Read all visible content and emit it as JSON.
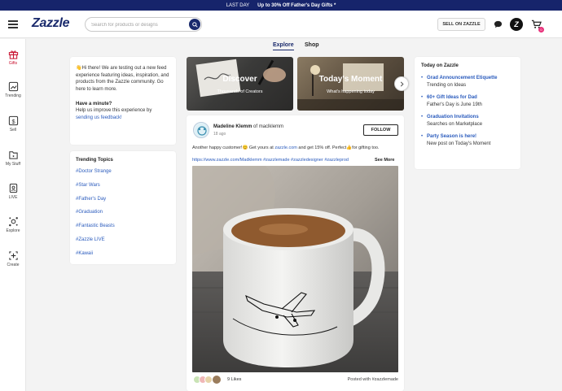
{
  "promo": {
    "label": "LAST DAY",
    "text": "Up to 30% Off Father's Day Gifts *"
  },
  "header": {
    "logo": "Zazzle",
    "search_placeholder": "Search for products or designs",
    "sell_label": "SELL ON ZAZZLE",
    "cart_count": "0"
  },
  "leftnav": [
    {
      "label": "Gifts",
      "icon": "gift-icon"
    },
    {
      "label": "Trending",
      "icon": "trending-icon"
    },
    {
      "label": "Sell",
      "icon": "dollar-icon"
    },
    {
      "label": "My Stuff",
      "icon": "my-stuff-icon"
    },
    {
      "label": "LIVE",
      "icon": "live-icon"
    },
    {
      "label": "Explore",
      "icon": "explore-icon"
    },
    {
      "label": "Create",
      "icon": "create-icon"
    }
  ],
  "tabs": [
    {
      "label": "Explore"
    },
    {
      "label": "Shop"
    }
  ],
  "welcome": {
    "intro": "Hi there! We are testing out a new feed experience featuring ideas, inspiration, and products from the Zazzle community. Go here to learn more.",
    "heading": "Have a minute?",
    "body": "Help us improve this experience by",
    "link": "sending us feedback!"
  },
  "trending": {
    "title": "Trending Topics",
    "topics": [
      "#Doctor Strange",
      "#Star Wars",
      "#Father's Day",
      "#Graduation",
      "#Fantastic Beasts",
      "#Zazzle LIVE",
      "#Kawaii"
    ]
  },
  "heroes": [
    {
      "title": "Discover",
      "subtitle": "Thousands of Creators"
    },
    {
      "title": "Today's Moment",
      "subtitle": "What's happening today"
    }
  ],
  "post": {
    "author": "Madeline Klemm",
    "handle": "of maclklemm",
    "time": "18 ago",
    "follow_label": "FOLLOW",
    "text_start": "Another happy customer!",
    "text_mid": "Get yours at",
    "text_link": "zazzle.com",
    "text_end": "and get 15% off. Perfect",
    "text_tail": "for gifting too.",
    "link_row": "https://www.zazzle.com/Madklemm #zazzlemade #zazzledesigner #zazzleprod",
    "see_more": "See More",
    "likes": "9 Likes",
    "posted_with": "Posted with #zazzlemade"
  },
  "today": {
    "title": "Today on Zazzle",
    "entries": [
      {
        "title": "Grad Announcement Etiquette",
        "sub": "Trending on Ideas"
      },
      {
        "title": "60+ Gift Ideas for Dad",
        "sub": "Father's Day is June 19th"
      },
      {
        "title": "Graduation Invitations",
        "sub": "Searches on Marketplace"
      },
      {
        "title": "Party Season is here!",
        "sub": "New post on Today's Moment"
      }
    ]
  },
  "colors": {
    "brand": "#1a2a6c",
    "link": "#2a5bbd",
    "accent": "#c8102e",
    "badge": "#e8327b"
  }
}
